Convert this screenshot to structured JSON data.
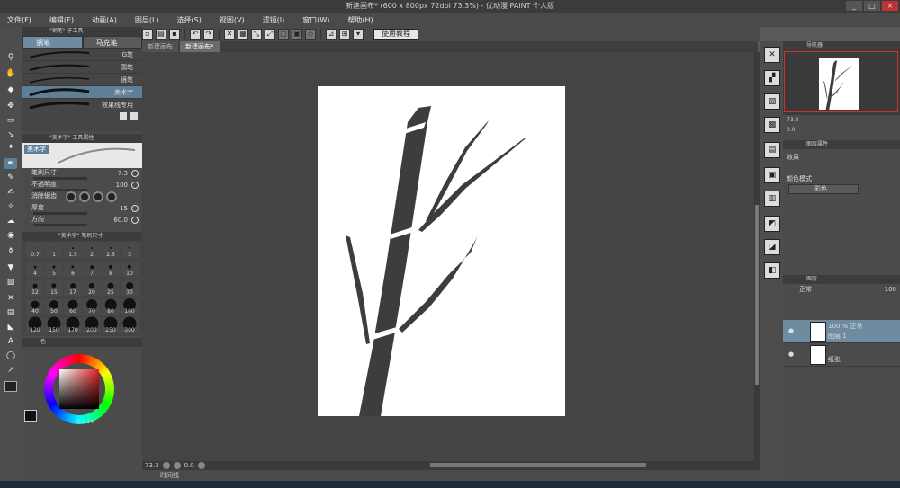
{
  "window": {
    "title": "新建画布* (600 x 800px 72dpi 73.3%)  - 优动漫 PAINT 个人版",
    "controls": [
      "_",
      "□",
      "×"
    ]
  },
  "menu": [
    "文件(F)",
    "编辑(E)",
    "动画(A)",
    "图层(L)",
    "选择(S)",
    "视图(V)",
    "滤镜(I)",
    "窗口(W)",
    "帮助(H)"
  ],
  "toolbar": {
    "tutorial_label": "使用教程"
  },
  "tabs": [
    {
      "label": "新建画布"
    },
    {
      "label": "新建画布*"
    }
  ],
  "subtool": {
    "header": "\"钢笔\" 子工具",
    "tabs": [
      "钢笔",
      "马克笔"
    ],
    "brushes": [
      {
        "name": "G笔"
      },
      {
        "name": "圆笔"
      },
      {
        "name": "镜笔"
      },
      {
        "name": "美术字"
      },
      {
        "name": "效果线专用"
      }
    ]
  },
  "tool_props": {
    "header": "\"美术字\" 工具属性",
    "preview_label": "美术字",
    "brush_size_label": "笔刷尺寸",
    "brush_size_value": "7.3",
    "opacity_label": "不透明度",
    "opacity_value": "100",
    "antialias_label": "消除锯齿",
    "thickness_label": "厚度",
    "thickness_value": "15",
    "direction_label": "方向",
    "direction_value": "60.0"
  },
  "brush_size": {
    "header": "\"美术字\" 笔刷尺寸",
    "sizes": [
      "0.7",
      "1",
      "1.5",
      "2",
      "2.5",
      "3",
      "4",
      "5",
      "6",
      "7",
      "8",
      "10",
      "12",
      "15",
      "17",
      "20",
      "25",
      "30",
      "40",
      "50",
      "60",
      "70",
      "80",
      "100",
      "120",
      "150",
      "170",
      "200",
      "250",
      "300"
    ]
  },
  "color": {
    "header": "色",
    "values": "0   0   24"
  },
  "canvas_status": {
    "zoom": "73.3",
    "angle": "0.0",
    "bottom_label": "时间线"
  },
  "navigator": {
    "header": "导航器",
    "zoom": "73.3",
    "angle": "0.0"
  },
  "layer_props": {
    "header": "图层属性",
    "effect_label": "效果",
    "blend_label": "颜色模式",
    "color_label": "彩色"
  },
  "layers": {
    "header": "图层",
    "mode": "正常",
    "opacity": "100",
    "items": [
      {
        "line1": "100 % 正常",
        "line2": "图层 1",
        "selected": true
      },
      {
        "line1": "",
        "line2": "纸张",
        "selected": false
      }
    ]
  }
}
